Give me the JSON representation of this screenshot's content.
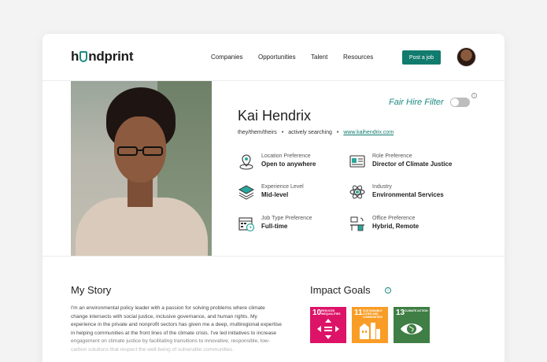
{
  "header": {
    "logo_text_pre": "h",
    "logo_text_post": "ndprint",
    "nav": [
      "Companies",
      "Opportunities",
      "Talent",
      "Resources"
    ],
    "post_job_label": "Post a job"
  },
  "profile": {
    "name": "Kai Hendrix",
    "pronouns": "they/them/theirs",
    "status": "actively searching",
    "website": "www.kaihendrix.com",
    "fair_hire_filter_label": "Fair Hire Filter",
    "attributes": [
      {
        "icon": "location-pin-icon",
        "label": "Location Preference",
        "value": "Open to anywhere"
      },
      {
        "icon": "id-card-icon",
        "label": "Role Preference",
        "value": "Director of Climate Justice"
      },
      {
        "icon": "layers-icon",
        "label": "Experience Level",
        "value": "Mid-level"
      },
      {
        "icon": "atom-icon",
        "label": "Industry",
        "value": "Environmental Services"
      },
      {
        "icon": "calendar-clock-icon",
        "label": "Job Type Preference",
        "value": "Full-time"
      },
      {
        "icon": "office-desk-icon",
        "label": "Office Preference",
        "value": "Hybrid, Remote"
      }
    ]
  },
  "story": {
    "heading": "My Story",
    "text": "I'm an environmental policy leader with a passion for solving problems where climate change intersects with social justice, inclusive governance, and human rights. My experience in the private and nonprofit sectors has given me a deep, multiregional expertise in helping communities at the front lines of the climate crisis. I've led initiatives to increase engagement on climate justice by facilitating transitions to innovative, responsible, low-carbon solutions that respect the well-being of vulnerable communities."
  },
  "goals": {
    "heading": "Impact Goals",
    "items": [
      {
        "num": "10",
        "title": "REDUCED INEQUALITIES",
        "color": "#dd1367"
      },
      {
        "num": "11",
        "title": "SUSTAINABLE CITIES AND COMMUNITIES",
        "color": "#f99d26"
      },
      {
        "num": "13",
        "title": "CLIMATE ACTION",
        "color": "#3f7e44"
      }
    ]
  },
  "colors": {
    "accent": "#117b6e",
    "teal_text": "#1e8b82"
  }
}
